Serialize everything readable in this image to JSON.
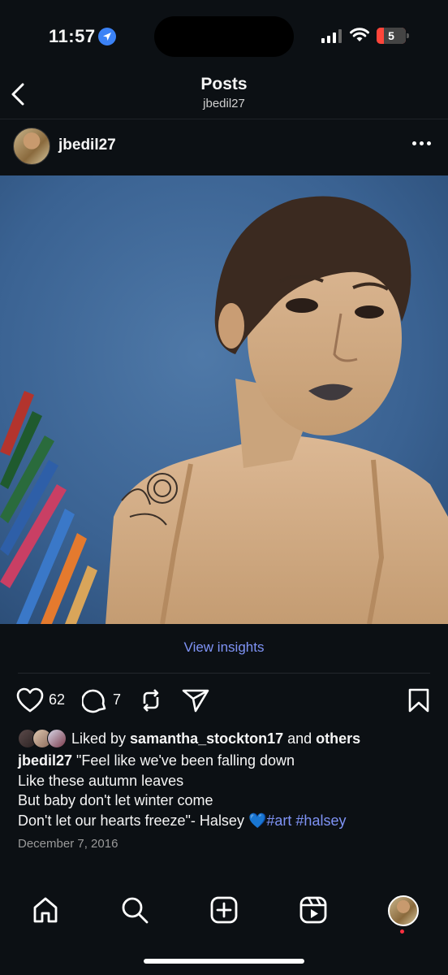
{
  "status_bar": {
    "time": "11:57",
    "battery": "5"
  },
  "header": {
    "title": "Posts",
    "subtitle": "jbedil27"
  },
  "post": {
    "username": "jbedil27",
    "view_insights": "View insights",
    "like_count": "62",
    "comment_count": "7",
    "liked_by_prefix": "Liked by ",
    "liked_by_user": "samantha_stockton17",
    "liked_by_and": " and ",
    "liked_by_others": "others",
    "caption_user": "jbedil27",
    "caption_lines": [
      " \"Feel like we've been falling down",
      "Like these autumn leaves",
      "But baby don't let winter come",
      "Don't let our hearts freeze\"- Halsey "
    ],
    "emoji": "💙",
    "hashtags": [
      "#art",
      "#halsey"
    ],
    "date": "December 7, 2016"
  },
  "colors": {
    "background": "#0c1014",
    "link": "#7f93f5",
    "accent": "#3b82f6"
  },
  "icons": {
    "status": [
      "location-arrow-icon",
      "cellular-signal-icon",
      "wifi-icon",
      "battery-icon"
    ],
    "actions": [
      "heart-icon",
      "comment-icon",
      "repost-icon",
      "send-icon",
      "bookmark-icon"
    ],
    "nav": [
      "home-icon",
      "search-icon",
      "create-icon",
      "reels-icon",
      "profile-avatar"
    ]
  }
}
